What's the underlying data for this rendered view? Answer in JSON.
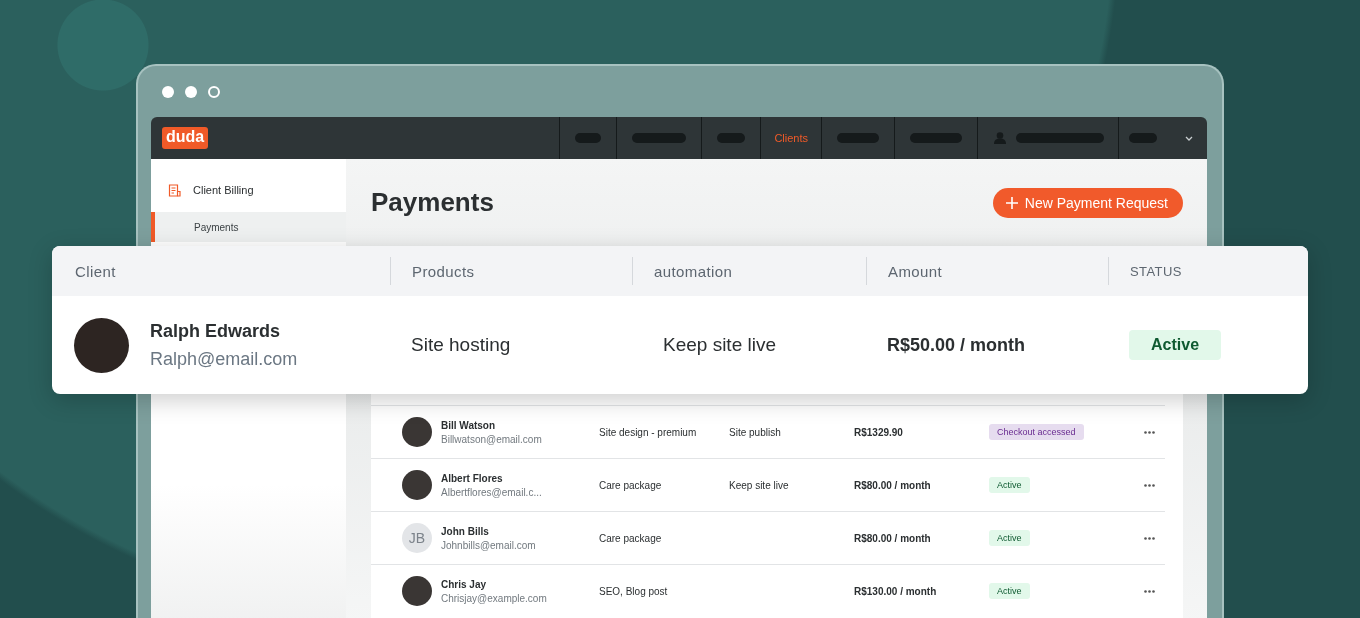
{
  "app": {
    "logo": "duda",
    "nav_items": [
      {
        "kind": "placeholder",
        "selected": false
      },
      {
        "kind": "placeholder",
        "selected": false
      },
      {
        "kind": "placeholder",
        "selected": false
      },
      {
        "kind": "link",
        "label": "Clients",
        "selected": true
      },
      {
        "kind": "placeholder",
        "selected": false
      },
      {
        "kind": "placeholder",
        "selected": false
      },
      {
        "kind": "account",
        "selected": false
      },
      {
        "kind": "menu",
        "selected": false
      }
    ]
  },
  "sidebar": {
    "items": [
      {
        "kind": "section",
        "label": "Client Billing",
        "selected": false
      },
      {
        "kind": "subitem",
        "label": "Payments",
        "selected": true
      }
    ]
  },
  "page": {
    "title": "Payments",
    "primary_button": "New Payment Request"
  },
  "featured_table": {
    "columns": [
      "Client",
      "Products",
      "automation",
      "Amount",
      "STATUS"
    ],
    "row": {
      "name": "Ralph Edwards",
      "email": "Ralph@email.com",
      "avatar": {
        "kind": "photo"
      },
      "products": "Site hosting",
      "automation": "Keep site live",
      "amount": "R$50.00 / month",
      "status": {
        "label": "Active",
        "kind": "active"
      }
    }
  },
  "table": {
    "rows": [
      {
        "name": "Bill Watson",
        "email": "Billwatson@email.com",
        "avatar": {
          "kind": "photo"
        },
        "products": "Site design - premium",
        "automation": "Site publish",
        "amount": "R$1329.90",
        "status": {
          "label": "Checkout accessed",
          "kind": "checkout"
        }
      },
      {
        "name": "Albert Flores",
        "email": "Albertflores@email.c...",
        "avatar": {
          "kind": "photo"
        },
        "products": "Care package",
        "automation": "Keep site live",
        "amount": "R$80.00 / month",
        "status": {
          "label": "Active",
          "kind": "active"
        }
      },
      {
        "name": "John Bills",
        "email": "Johnbills@email.com",
        "avatar": {
          "kind": "initials",
          "text": "JB"
        },
        "products": "Care package",
        "amount": "R$80.00 / month",
        "status": {
          "label": "Active",
          "kind": "active"
        }
      },
      {
        "name": "Chris Jay",
        "email": "Chrisjay@example.com",
        "avatar": {
          "kind": "photo"
        },
        "products": "SEO, Blog post",
        "amount": "R$130.00 / month",
        "status": {
          "label": "Active",
          "kind": "active"
        }
      }
    ]
  }
}
